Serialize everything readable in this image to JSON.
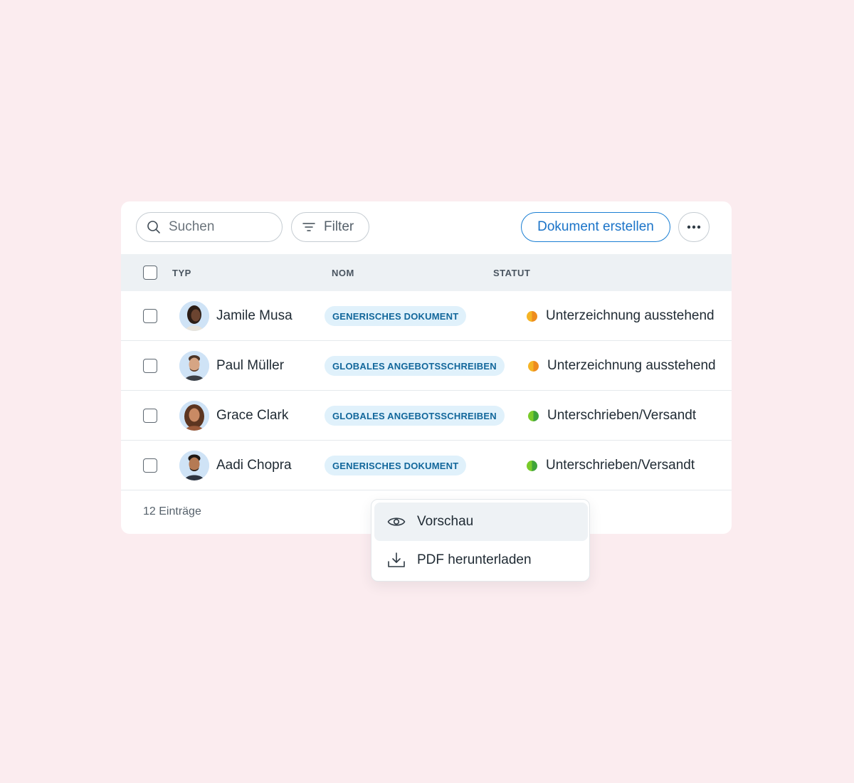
{
  "toolbar": {
    "search_placeholder": "Suchen",
    "filter_label": "Filter",
    "create_label": "Dokument erstellen",
    "more_icon": "more-horizontal-icon"
  },
  "table": {
    "columns": [
      "TYP",
      "NOM",
      "STATUT"
    ],
    "rows": [
      {
        "name": "Jamile Musa",
        "type": "GENERISCHES DOKUMENT",
        "status": "Unterzeichnung ausstehend",
        "status_kind": "pending"
      },
      {
        "name": "Paul Müller",
        "type": "GLOBALES ANGEBOTSSCHREIBEN",
        "status": "Unterzeichnung ausstehend",
        "status_kind": "pending"
      },
      {
        "name": "Grace Clark",
        "type": "GLOBALES ANGEBOTSSCHREIBEN",
        "status": "Unterschrieben/Versandt",
        "status_kind": "signed"
      },
      {
        "name": "Aadi Chopra",
        "type": "GENERISCHES DOKUMENT",
        "status": "Unterschrieben/Versandt",
        "status_kind": "signed"
      }
    ]
  },
  "footer": {
    "entries": "12 Einträge"
  },
  "context_menu": {
    "items": [
      {
        "label": "Vorschau",
        "icon": "eye-icon"
      },
      {
        "label": "PDF herunterladen",
        "icon": "download-icon"
      }
    ]
  },
  "colors": {
    "background": "#fbecef",
    "accent": "#1a73c8",
    "pending": "#f5a623",
    "signed": "#4caf36"
  }
}
